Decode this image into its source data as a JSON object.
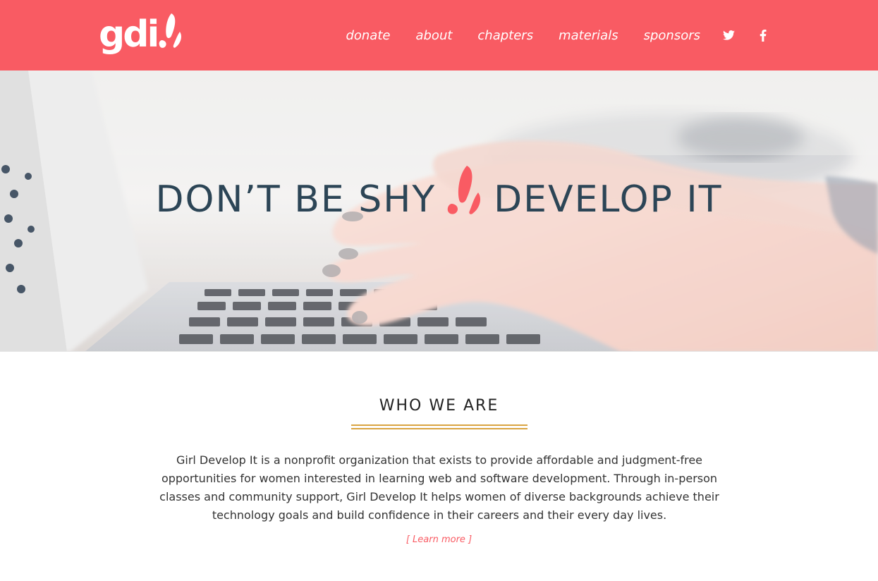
{
  "brand": {
    "logo_text": "gdi",
    "colors": {
      "primary": "#f95b63",
      "heading": "#2c4556",
      "accent_rule": "#d9a441"
    }
  },
  "nav": {
    "items": [
      {
        "label": "donate"
      },
      {
        "label": "about"
      },
      {
        "label": "chapters"
      },
      {
        "label": "materials"
      },
      {
        "label": "sponsors"
      }
    ],
    "social": [
      {
        "icon": "twitter-icon"
      },
      {
        "icon": "facebook-icon"
      }
    ]
  },
  "hero": {
    "title_left": "DON’T BE SHY",
    "title_right": "DEVELOP IT",
    "image": "hands-typing-on-laptop"
  },
  "about": {
    "title": "WHO WE ARE",
    "body": "Girl Develop It is a nonprofit organization that exists to provide affordable and judgment-free opportunities for women interested in learning web and software development. Through in-person classes and community support, Girl Develop It helps women of diverse backgrounds achieve their technology goals and build confidence in their careers and their every day lives.",
    "learn_more": "[ Learn more ]"
  }
}
